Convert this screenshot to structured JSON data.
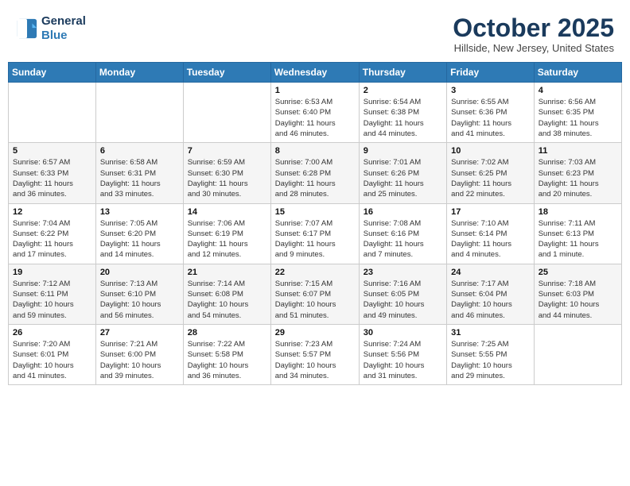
{
  "header": {
    "logo_line1": "General",
    "logo_line2": "Blue",
    "month": "October 2025",
    "location": "Hillside, New Jersey, United States"
  },
  "weekdays": [
    "Sunday",
    "Monday",
    "Tuesday",
    "Wednesday",
    "Thursday",
    "Friday",
    "Saturday"
  ],
  "weeks": [
    [
      {
        "day": "",
        "info": ""
      },
      {
        "day": "",
        "info": ""
      },
      {
        "day": "",
        "info": ""
      },
      {
        "day": "1",
        "info": "Sunrise: 6:53 AM\nSunset: 6:40 PM\nDaylight: 11 hours\nand 46 minutes."
      },
      {
        "day": "2",
        "info": "Sunrise: 6:54 AM\nSunset: 6:38 PM\nDaylight: 11 hours\nand 44 minutes."
      },
      {
        "day": "3",
        "info": "Sunrise: 6:55 AM\nSunset: 6:36 PM\nDaylight: 11 hours\nand 41 minutes."
      },
      {
        "day": "4",
        "info": "Sunrise: 6:56 AM\nSunset: 6:35 PM\nDaylight: 11 hours\nand 38 minutes."
      }
    ],
    [
      {
        "day": "5",
        "info": "Sunrise: 6:57 AM\nSunset: 6:33 PM\nDaylight: 11 hours\nand 36 minutes."
      },
      {
        "day": "6",
        "info": "Sunrise: 6:58 AM\nSunset: 6:31 PM\nDaylight: 11 hours\nand 33 minutes."
      },
      {
        "day": "7",
        "info": "Sunrise: 6:59 AM\nSunset: 6:30 PM\nDaylight: 11 hours\nand 30 minutes."
      },
      {
        "day": "8",
        "info": "Sunrise: 7:00 AM\nSunset: 6:28 PM\nDaylight: 11 hours\nand 28 minutes."
      },
      {
        "day": "9",
        "info": "Sunrise: 7:01 AM\nSunset: 6:26 PM\nDaylight: 11 hours\nand 25 minutes."
      },
      {
        "day": "10",
        "info": "Sunrise: 7:02 AM\nSunset: 6:25 PM\nDaylight: 11 hours\nand 22 minutes."
      },
      {
        "day": "11",
        "info": "Sunrise: 7:03 AM\nSunset: 6:23 PM\nDaylight: 11 hours\nand 20 minutes."
      }
    ],
    [
      {
        "day": "12",
        "info": "Sunrise: 7:04 AM\nSunset: 6:22 PM\nDaylight: 11 hours\nand 17 minutes."
      },
      {
        "day": "13",
        "info": "Sunrise: 7:05 AM\nSunset: 6:20 PM\nDaylight: 11 hours\nand 14 minutes."
      },
      {
        "day": "14",
        "info": "Sunrise: 7:06 AM\nSunset: 6:19 PM\nDaylight: 11 hours\nand 12 minutes."
      },
      {
        "day": "15",
        "info": "Sunrise: 7:07 AM\nSunset: 6:17 PM\nDaylight: 11 hours\nand 9 minutes."
      },
      {
        "day": "16",
        "info": "Sunrise: 7:08 AM\nSunset: 6:16 PM\nDaylight: 11 hours\nand 7 minutes."
      },
      {
        "day": "17",
        "info": "Sunrise: 7:10 AM\nSunset: 6:14 PM\nDaylight: 11 hours\nand 4 minutes."
      },
      {
        "day": "18",
        "info": "Sunrise: 7:11 AM\nSunset: 6:13 PM\nDaylight: 11 hours\nand 1 minute."
      }
    ],
    [
      {
        "day": "19",
        "info": "Sunrise: 7:12 AM\nSunset: 6:11 PM\nDaylight: 10 hours\nand 59 minutes."
      },
      {
        "day": "20",
        "info": "Sunrise: 7:13 AM\nSunset: 6:10 PM\nDaylight: 10 hours\nand 56 minutes."
      },
      {
        "day": "21",
        "info": "Sunrise: 7:14 AM\nSunset: 6:08 PM\nDaylight: 10 hours\nand 54 minutes."
      },
      {
        "day": "22",
        "info": "Sunrise: 7:15 AM\nSunset: 6:07 PM\nDaylight: 10 hours\nand 51 minutes."
      },
      {
        "day": "23",
        "info": "Sunrise: 7:16 AM\nSunset: 6:05 PM\nDaylight: 10 hours\nand 49 minutes."
      },
      {
        "day": "24",
        "info": "Sunrise: 7:17 AM\nSunset: 6:04 PM\nDaylight: 10 hours\nand 46 minutes."
      },
      {
        "day": "25",
        "info": "Sunrise: 7:18 AM\nSunset: 6:03 PM\nDaylight: 10 hours\nand 44 minutes."
      }
    ],
    [
      {
        "day": "26",
        "info": "Sunrise: 7:20 AM\nSunset: 6:01 PM\nDaylight: 10 hours\nand 41 minutes."
      },
      {
        "day": "27",
        "info": "Sunrise: 7:21 AM\nSunset: 6:00 PM\nDaylight: 10 hours\nand 39 minutes."
      },
      {
        "day": "28",
        "info": "Sunrise: 7:22 AM\nSunset: 5:58 PM\nDaylight: 10 hours\nand 36 minutes."
      },
      {
        "day": "29",
        "info": "Sunrise: 7:23 AM\nSunset: 5:57 PM\nDaylight: 10 hours\nand 34 minutes."
      },
      {
        "day": "30",
        "info": "Sunrise: 7:24 AM\nSunset: 5:56 PM\nDaylight: 10 hours\nand 31 minutes."
      },
      {
        "day": "31",
        "info": "Sunrise: 7:25 AM\nSunset: 5:55 PM\nDaylight: 10 hours\nand 29 minutes."
      },
      {
        "day": "",
        "info": ""
      }
    ]
  ]
}
